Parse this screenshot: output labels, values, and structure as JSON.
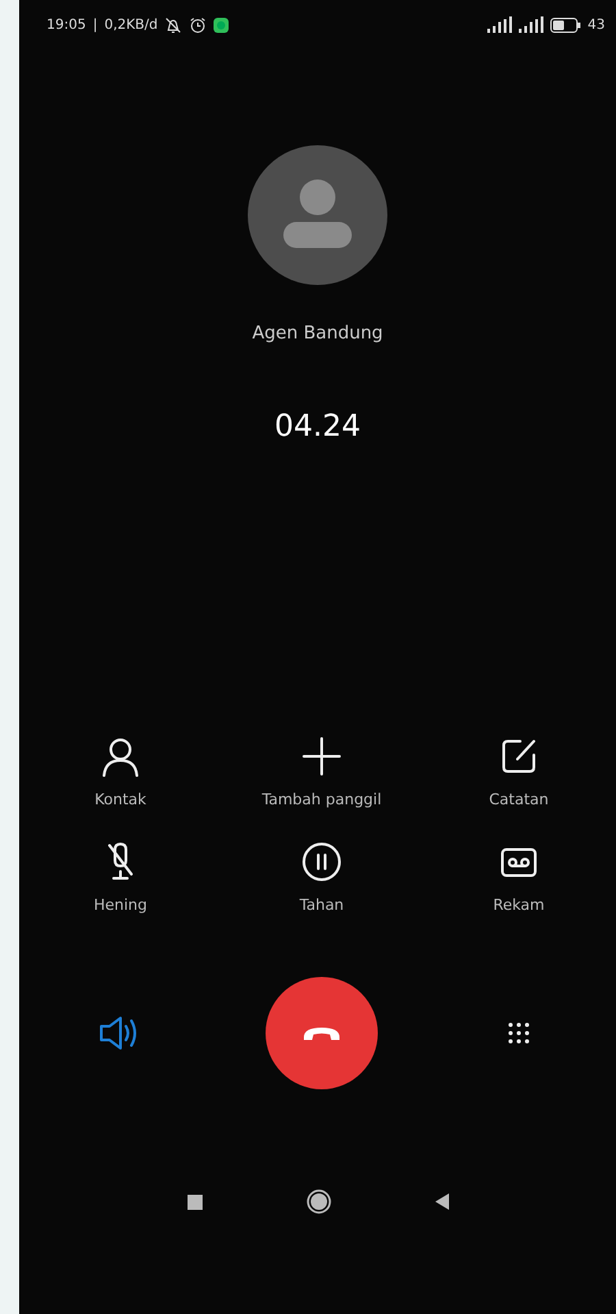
{
  "status_bar": {
    "time": "19:05",
    "separator": "|",
    "speed": "0,2KB/d",
    "battery_text": "43"
  },
  "caller": {
    "name": "Agen Bandung",
    "duration": "04.24"
  },
  "controls": [
    {
      "kind": "contact",
      "label": "Kontak"
    },
    {
      "kind": "add",
      "label": "Tambah panggil"
    },
    {
      "kind": "note",
      "label": "Catatan"
    },
    {
      "kind": "mute",
      "label": "Hening"
    },
    {
      "kind": "hold",
      "label": "Tahan"
    },
    {
      "kind": "record",
      "label": "Rekam"
    }
  ],
  "speaker": {
    "selected": true
  }
}
